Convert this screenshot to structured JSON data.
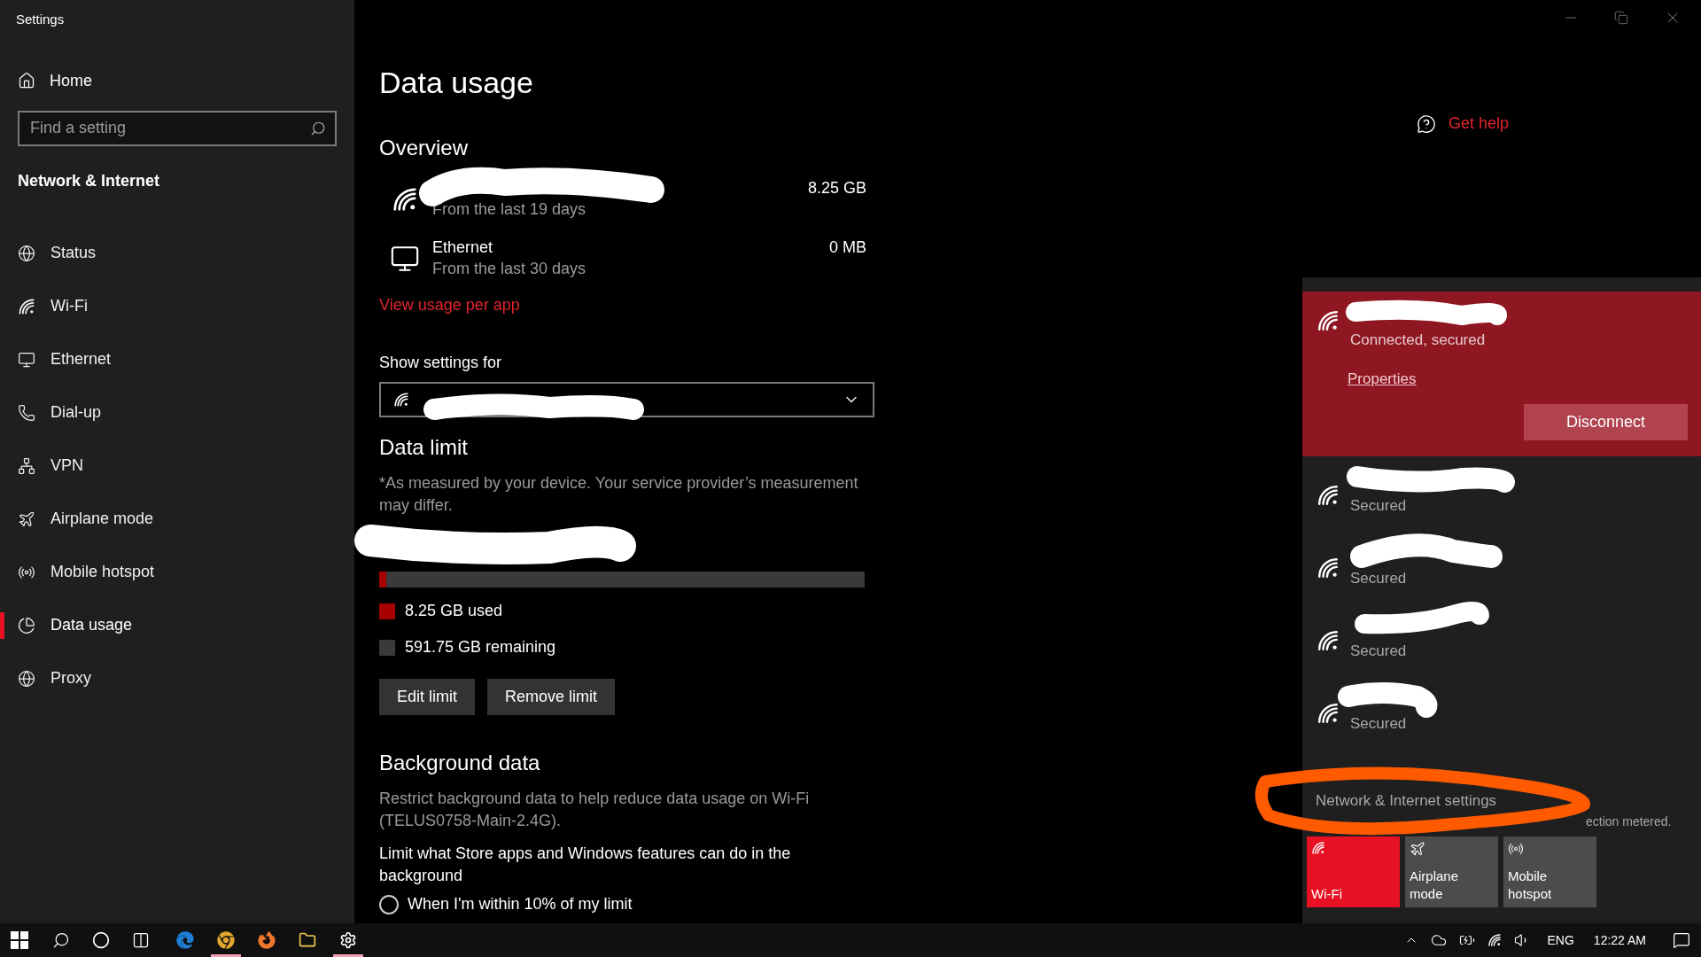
{
  "window": {
    "title": "Settings"
  },
  "sidebar": {
    "home": "Home",
    "search": {
      "placeholder": "Find a setting"
    },
    "section": "Network & Internet",
    "items": [
      {
        "label": "Status",
        "selected": false
      },
      {
        "label": "Wi-Fi",
        "selected": false
      },
      {
        "label": "Ethernet",
        "selected": false
      },
      {
        "label": "Dial-up",
        "selected": false
      },
      {
        "label": "VPN",
        "selected": false
      },
      {
        "label": "Airplane mode",
        "selected": false
      },
      {
        "label": "Mobile hotspot",
        "selected": false
      },
      {
        "label": "Data usage",
        "selected": true
      },
      {
        "label": "Proxy",
        "selected": false
      }
    ]
  },
  "page": {
    "title": "Data usage",
    "get_help": "Get help",
    "overview": {
      "heading": "Overview",
      "connections": [
        {
          "kind": "wifi",
          "period": "From the last 19 days",
          "amount": "8.25 GB"
        },
        {
          "kind": "ethernet",
          "name": "Ethernet",
          "period": "From the last 30 days",
          "amount": "0 MB"
        }
      ],
      "link": "View usage per app"
    },
    "show_settings_for": {
      "label": "Show settings for"
    },
    "data_limit": {
      "heading": "Data limit",
      "note": "*As measured by your device. Your service provider’s measurement may differ.",
      "level": 0.014,
      "legend": [
        {
          "label": "8.25 GB used",
          "color": "#a80000"
        },
        {
          "label": "591.75 GB remaining",
          "color": "#3a3a3a"
        }
      ],
      "buttons": [
        "Edit limit",
        "Remove limit"
      ]
    },
    "background_data": {
      "heading": "Background data",
      "description": "Restrict background data to help reduce data usage on Wi-Fi (TELUS0758-Main-2.4G).",
      "question": "Limit what Store apps and Windows features can do in the background",
      "options": [
        {
          "label": "When I'm within 10% of my limit",
          "selected": false
        }
      ]
    }
  },
  "network_flyout": {
    "connected": {
      "status": "Connected, secured",
      "link": "Properties",
      "button": "Disconnect"
    },
    "networks": [
      {
        "status": "Secured"
      },
      {
        "status": "Secured"
      },
      {
        "status": "Secured"
      },
      {
        "status": "Secured"
      }
    ],
    "settings_link": "Network & Internet settings",
    "footer_fragment": "ection metered.",
    "quick_actions": [
      {
        "label": "Wi-Fi",
        "on": true
      },
      {
        "label": "Airplane mode",
        "on": false
      },
      {
        "label": "Mobile hotspot",
        "on": false
      }
    ]
  },
  "taskbar": {
    "apps": [
      {
        "running": false
      },
      {
        "running": true
      },
      {
        "running": false
      },
      {
        "running": false
      },
      {
        "running": true
      }
    ],
    "language": "ENG",
    "time": "12:22 AM"
  }
}
